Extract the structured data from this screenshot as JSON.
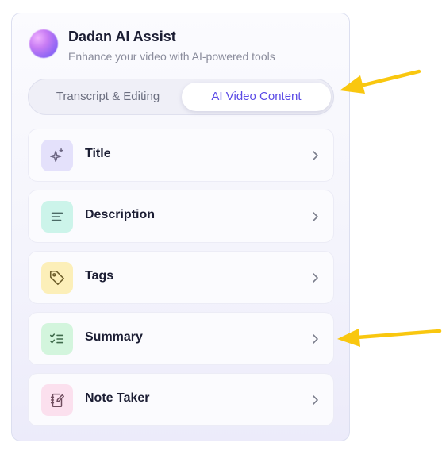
{
  "header": {
    "title": "Dadan AI Assist",
    "subtitle": "Enhance your video with AI-powered tools"
  },
  "tabs": [
    {
      "label": "Transcript & Editing",
      "active": false
    },
    {
      "label": "AI Video Content",
      "active": true
    }
  ],
  "items": [
    {
      "label": "Title",
      "icon": "sparkle-icon",
      "color": "#e4e1fb"
    },
    {
      "label": "Description",
      "icon": "text-lines-icon",
      "color": "#ccf4ea"
    },
    {
      "label": "Tags",
      "icon": "tag-icon",
      "color": "#fcefb9"
    },
    {
      "label": "Summary",
      "icon": "checklist-icon",
      "color": "#d3f5dd"
    },
    {
      "label": "Note Taker",
      "icon": "notebook-pen-icon",
      "color": "#fbe0ee"
    }
  ],
  "colors": {
    "accent": "#5b4be6",
    "annotation_arrow": "#f9c70f"
  }
}
